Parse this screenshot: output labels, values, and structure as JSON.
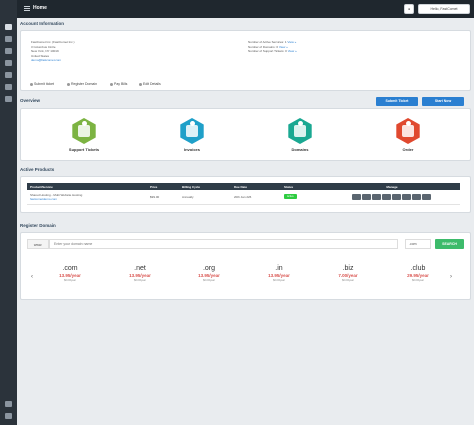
{
  "topbar": {
    "crumb": "Home",
    "bell_label": "",
    "user_label": "Hello, FastComet"
  },
  "account": {
    "title": "Account Information",
    "address_lines": [
      "FastComet Inc. (FastComet Inc.)",
      "3 Columbus Circle",
      "New York, NY 10019",
      "United States",
      "demo@fastcomet.com"
    ],
    "stats": [
      {
        "text": "Number of Active Services: 1",
        "link": "View »"
      },
      {
        "text": "Number of Domains: 0",
        "link": "View »"
      },
      {
        "text": "Number of Support Tickets: 0",
        "link": "View »"
      }
    ],
    "actions": [
      "Submit ticket",
      "Register Domain",
      "Pay Bills",
      "Edit Details"
    ]
  },
  "overview": {
    "title": "Overview",
    "submit_ticket": "Submit Ticket",
    "start_now": "Start Now",
    "items": [
      {
        "label": "Support Tickets",
        "color": "#7cb342",
        "icon": "ticket-icon"
      },
      {
        "label": "Invoices",
        "color": "#1fa0c9",
        "icon": "invoice-icon"
      },
      {
        "label": "Domains",
        "color": "#1aa892",
        "icon": "domains-icon"
      },
      {
        "label": "Order",
        "color": "#e0492f",
        "icon": "cart-icon"
      }
    ]
  },
  "products": {
    "title": "Active Products",
    "headers": [
      "Product/Service",
      "Price",
      "Billing Cycle",
      "Due Date",
      "Status",
      "Manage"
    ],
    "row": {
      "product": "Shared Hosting - Multi Website Hosting",
      "domain": "fastcometdemo.com",
      "price": "$99.00",
      "cycle": "Annually",
      "due": "20th Jan 226",
      "status": "Active"
    }
  },
  "register": {
    "title": "Register Domain",
    "www": "www.",
    "placeholder": "Enter your domain name",
    "tld_selected": ".com",
    "search": "SEARCH",
    "tlds": [
      {
        "name": ".com",
        "price": "13.95/year",
        "renew": "$0.00/year"
      },
      {
        "name": ".net",
        "price": "13.95/year",
        "renew": "$0.00/year"
      },
      {
        "name": ".org",
        "price": "13.95/year",
        "renew": "$0.00/year"
      },
      {
        "name": ".in",
        "price": "13.95/year",
        "renew": "$0.00/year"
      },
      {
        "name": ".biz",
        "price": "7.00/year",
        "renew": "$0.00/year"
      },
      {
        "name": ".club",
        "price": "29.95/year",
        "renew": "$0.00/year"
      }
    ],
    "prev": "‹",
    "next": "›"
  }
}
